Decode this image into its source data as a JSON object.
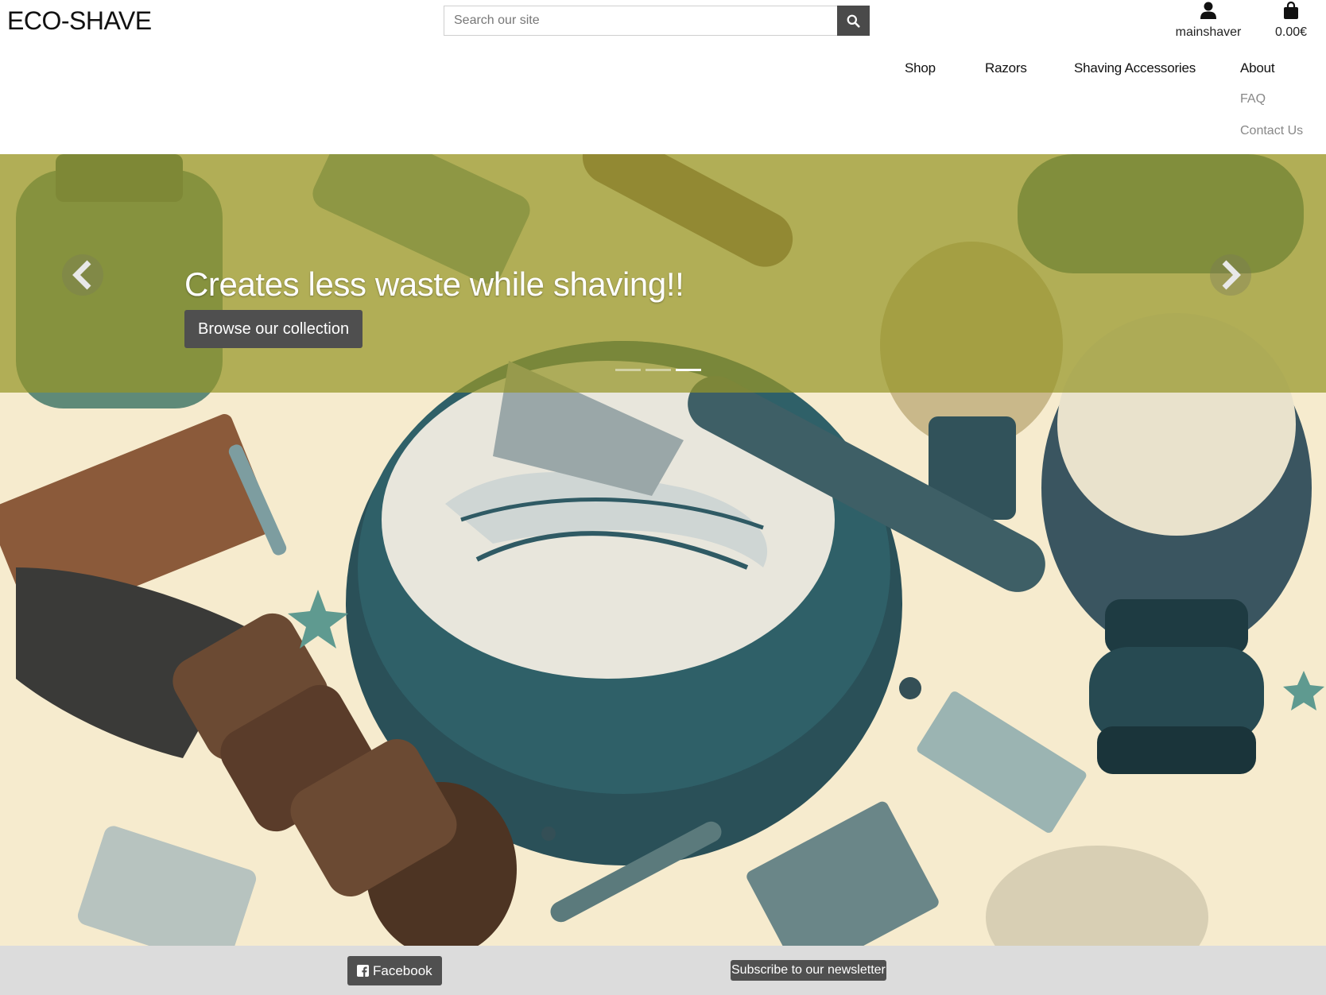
{
  "header": {
    "brand": "ECO-SHAVE",
    "search_placeholder": "Search our site",
    "search_icon": "search-icon",
    "account_label": "mainshaver",
    "account_icon": "user-icon",
    "cart_total": "0.00€",
    "cart_icon": "shopping-bag-icon"
  },
  "nav": {
    "items": [
      {
        "label": "Shop"
      },
      {
        "label": "Razors"
      },
      {
        "label": "Shaving Accessories"
      },
      {
        "label": "About"
      }
    ],
    "about_dropdown": [
      {
        "label": "FAQ"
      },
      {
        "label": "Contact Us"
      }
    ]
  },
  "hero": {
    "caption": "Creates less waste while shaving!!",
    "cta_label": "Browse our collection",
    "prev_icon": "chevron-left-icon",
    "next_icon": "chevron-right-icon",
    "slide_count": 3,
    "active_slide": 3,
    "overlay_color": "#96962880"
  },
  "footer": {
    "facebook_label": "Facebook",
    "facebook_icon": "facebook-square-icon",
    "newsletter_label": "Subscribe to our newsletter"
  },
  "colors": {
    "button_dark": "#4f4f4f",
    "footer_bg": "#dcdcdc",
    "overlay": "#969628"
  }
}
